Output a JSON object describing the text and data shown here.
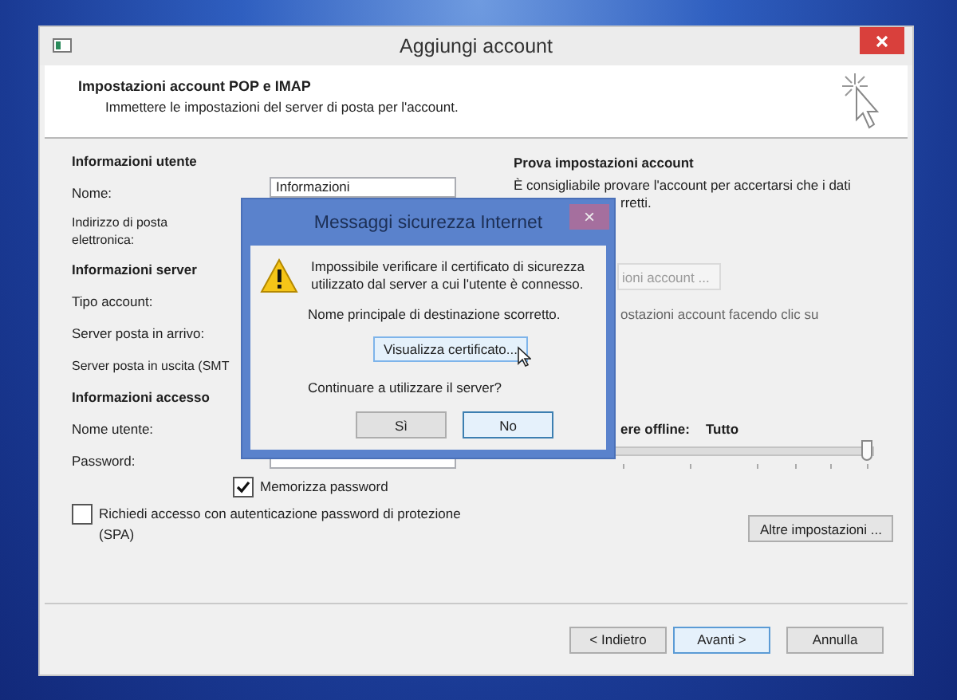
{
  "window": {
    "title": "Aggiungi account"
  },
  "header": {
    "title": "Impostazioni account POP e IMAP",
    "subtitle": "Immettere le impostazioni del server di posta per l'account."
  },
  "user_form": [
    {
      "kind": "heading",
      "text": "Informazioni utente"
    },
    {
      "kind": "input",
      "label": "Nome:",
      "value": "Informazioni"
    },
    {
      "kind": "label",
      "label": "Indirizzo di posta\nelettronica:"
    },
    {
      "kind": "heading",
      "text": "Informazioni server"
    },
    {
      "kind": "label",
      "label": "Tipo account:"
    },
    {
      "kind": "label",
      "label": "Server posta in arrivo:"
    },
    {
      "kind": "label",
      "label": "Server posta in uscita (SMT"
    },
    {
      "kind": "heading",
      "text": "Informazioni accesso"
    },
    {
      "kind": "label",
      "label": "Nome utente:"
    },
    {
      "kind": "input",
      "label": "Password:"
    },
    {
      "kind": "checkbox",
      "label": "Memorizza password",
      "checked": true,
      "indented": true
    },
    {
      "kind": "checkbox",
      "label": "Richiedi accesso con autenticazione password di protezione (SPA)",
      "checked": false
    }
  ],
  "test_panel": {
    "title": "Prova impostazioni account",
    "text": "È consigliabile provare l'account per accertarsi che i dati",
    "text_tail": "rretti.",
    "test_button": {
      "label": "ioni account ...",
      "disabled": true
    },
    "hint_tail": "ostazioni account facendo clic su",
    "offline_label": "ere offline:",
    "offline_value": "Tutto",
    "offline_slider": {
      "level": 1
    },
    "more_button": "Altre impostazioni ..."
  },
  "footer_buttons": [
    {
      "label": "< Indietro",
      "default": false
    },
    {
      "label": "Avanti >",
      "default": true
    },
    {
      "label": "Annulla",
      "default": false
    }
  ],
  "alert": {
    "title": "Messaggi sicurezza Internet",
    "close": "×",
    "message": "Impossibile verificare il certificato di sicurezza utilizzato dal server a cui l'utente è connesso.",
    "detail": "Nome principale di destinazione scorretto.",
    "view_button": "Visualizza certificato...",
    "question": "Continuare a utilizzare il server?",
    "buttons": [
      {
        "label": "Sì",
        "default": false
      },
      {
        "label": "No",
        "default": true
      }
    ]
  }
}
